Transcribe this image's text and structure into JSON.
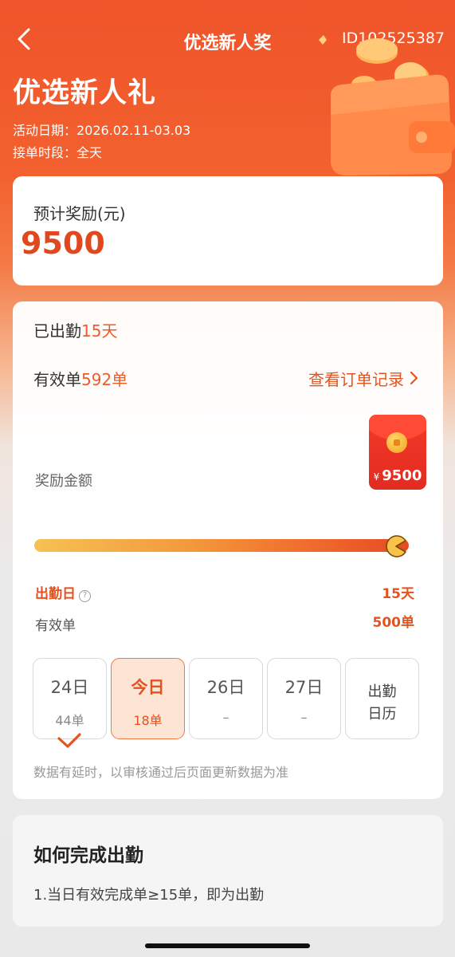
{
  "header": {
    "nav_title": "优选新人奖",
    "activity_id": "ID102525387",
    "page_title": "优选新人礼",
    "activity_date": "活动日期：2026.02.11-03.03",
    "order_period": "接单时段：全天"
  },
  "reward": {
    "label": "预计奖励(元)",
    "amount": "9500"
  },
  "progress": {
    "attended_prefix": "已出勤",
    "attended_value": "15天",
    "valid_prefix": "有效单",
    "valid_value": "592单",
    "order_link": "查看订单记录",
    "reward_amount_label": "奖励金额",
    "red_packet_currency": "¥",
    "red_packet_amount": "9500",
    "progress_fraction": 1.0,
    "attend_day_label": "出勤日",
    "attend_day_value": "15天",
    "valid_orders_label": "有效单",
    "valid_orders_value": "500单",
    "help_icon": "question-circle-icon",
    "days": [
      {
        "day": "24日",
        "count": "44单",
        "checked": true
      },
      {
        "day": "今日",
        "count": "18单",
        "today": true
      },
      {
        "day": "26日",
        "count": "–"
      },
      {
        "day": "27日",
        "count": "–"
      }
    ],
    "calendar_line1": "出勤",
    "calendar_line2": "日历",
    "delay_note": "数据有延时，以审核通过后页面更新数据为准"
  },
  "how": {
    "title": "如何完成出勤",
    "rule": "1.当日有效完成单≥15单，即为出勤"
  },
  "colors": {
    "accent": "#e4531f",
    "header_bg": "#f0542a",
    "red_packet": "#e22c20"
  }
}
